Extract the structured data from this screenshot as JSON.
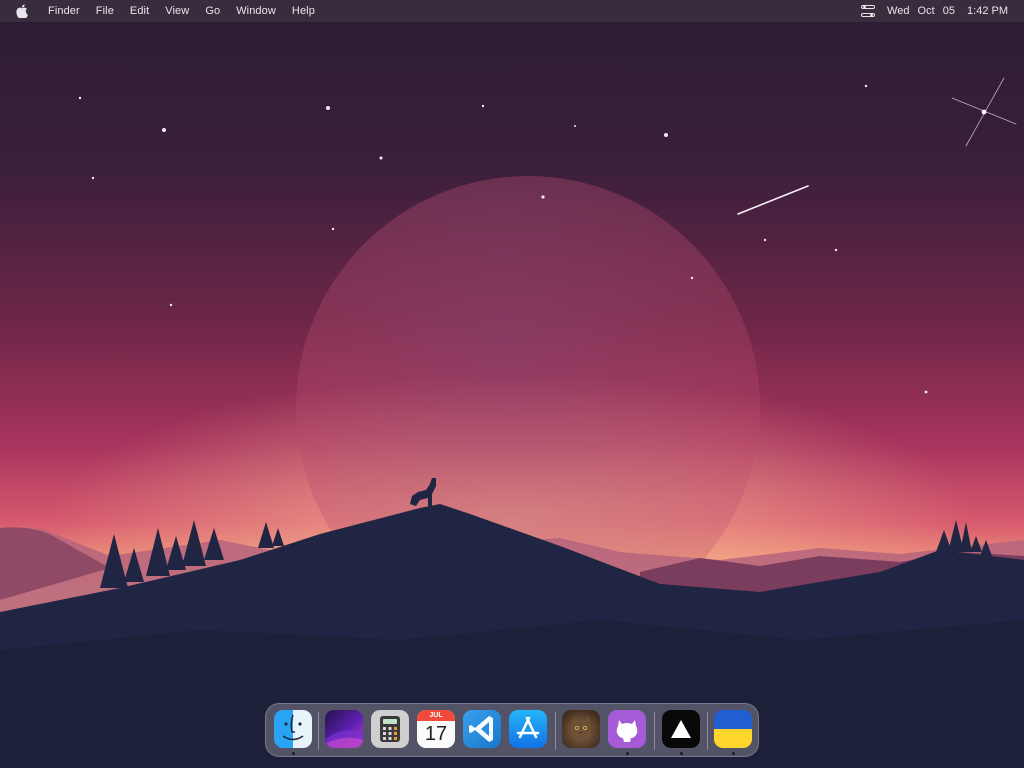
{
  "menubar": {
    "apple_icon": "apple-logo-icon",
    "app_name": "Finder",
    "items": [
      "File",
      "Edit",
      "View",
      "Go",
      "Window",
      "Help"
    ],
    "control_center_icon": "control-center-icon",
    "clock": {
      "day": "Wed",
      "month": "Oct",
      "date": "05",
      "time": "1:42 PM"
    }
  },
  "dock": {
    "items": [
      {
        "name": "finder-icon",
        "running": true
      },
      {
        "name": "dark-wallpaper-app-icon",
        "running": false
      },
      {
        "name": "calculator-icon",
        "running": false
      },
      {
        "name": "calendar-icon",
        "running": false,
        "month": "JUL",
        "day": "17"
      },
      {
        "name": "vscode-icon",
        "running": false
      },
      {
        "name": "app-store-icon",
        "running": false
      },
      {
        "name": "cat-photo-icon",
        "running": false
      },
      {
        "name": "github-desktop-icon",
        "running": true
      },
      {
        "name": "vercel-icon",
        "running": true
      },
      {
        "name": "ukraine-flag-icon",
        "running": true
      }
    ]
  },
  "colors": {
    "sky_top": "#2b1d34",
    "sky_mid": "#a8345e",
    "horizon": "#f3a070",
    "hill": "#1f2542"
  }
}
